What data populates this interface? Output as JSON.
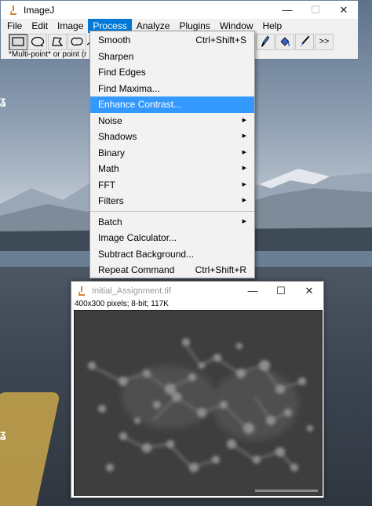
{
  "main_window": {
    "title": "ImageJ",
    "minimize": "—",
    "maximize": "☐",
    "close": "✕",
    "menus": [
      "File",
      "Edit",
      "Image",
      "Process",
      "Analyze",
      "Plugins",
      "Window",
      "Help"
    ],
    "active_menu": "Process",
    "more_tools": ">>",
    "status": "*Multi-point* or point (r"
  },
  "process_menu": {
    "items": [
      {
        "label": "Smooth",
        "shortcut": "Ctrl+Shift+S"
      },
      {
        "label": "Sharpen"
      },
      {
        "label": "Find Edges"
      },
      {
        "label": "Find Maxima..."
      },
      {
        "label": "Enhance Contrast...",
        "highlighted": true
      },
      {
        "label": "Noise",
        "submenu": true
      },
      {
        "label": "Shadows",
        "submenu": true
      },
      {
        "label": "Binary",
        "submenu": true
      },
      {
        "label": "Math",
        "submenu": true
      },
      {
        "label": "FFT",
        "submenu": true
      },
      {
        "label": "Filters",
        "submenu": true
      },
      {
        "label": "Batch",
        "submenu": true
      },
      {
        "label": "Image Calculator..."
      },
      {
        "label": "Subtract Background..."
      },
      {
        "label": "Repeat Command",
        "shortcut": "Ctrl+Shift+R"
      }
    ]
  },
  "image_window": {
    "title": "Initial_Assignment.tif",
    "minimize": "—",
    "maximize": "☐",
    "close": "✕",
    "info": "400x300 pixels; 8-bit; 117K"
  },
  "colors": {
    "menu_active": "#0078d7",
    "item_highlight": "#3399ff"
  },
  "icons": {
    "app": "microscope-icon",
    "tools": [
      "rectangle-tool-icon",
      "oval-tool-icon",
      "polygon-tool-icon",
      "freehand-tool-icon",
      "line-tool-icon",
      "dropper-icon",
      "brush-icon",
      "fill-icon",
      "pen-icon"
    ]
  }
}
